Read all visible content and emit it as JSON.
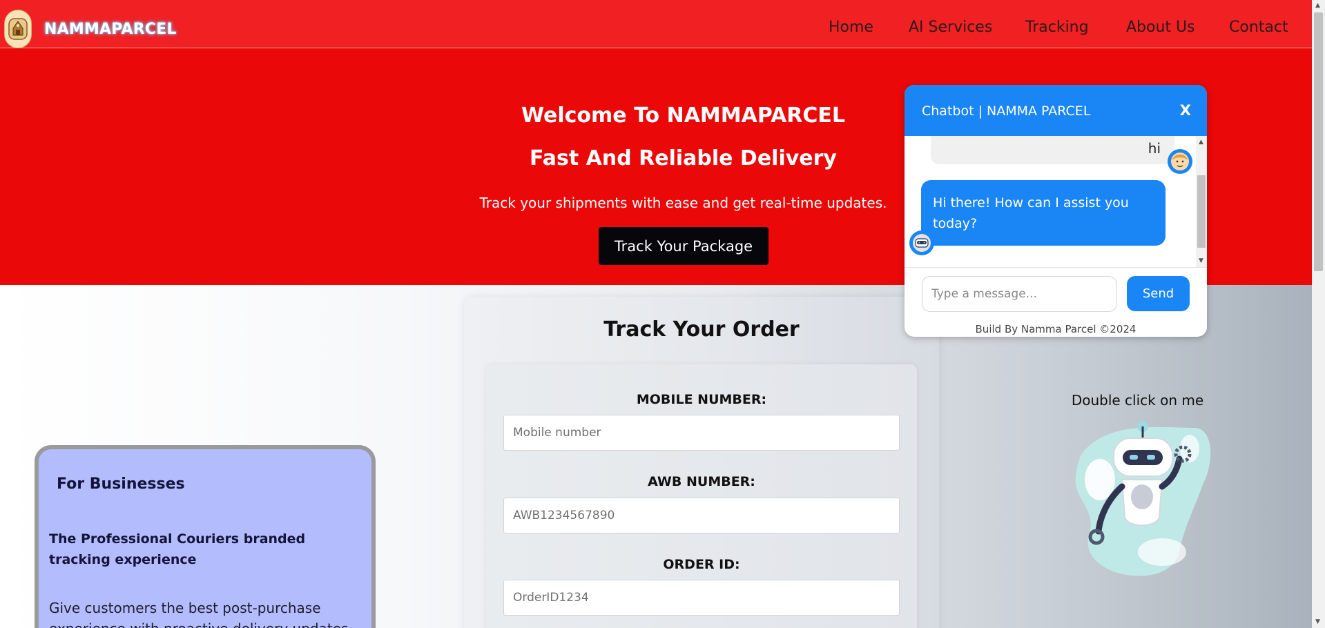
{
  "brand": {
    "name": "NAMMAPARCEL",
    "logo_icon": "temple-logo-icon"
  },
  "nav": {
    "items": [
      {
        "label": "Home"
      },
      {
        "label": "AI Services"
      },
      {
        "label": "Tracking"
      },
      {
        "label": "About Us"
      },
      {
        "label": "Contact"
      }
    ]
  },
  "hero": {
    "title_1": "Welcome To NAMMAPARCEL",
    "title_2": "Fast And Reliable Delivery",
    "subtitle": "Track your shipments with ease and get real-time updates.",
    "button_label": "Track Your Package"
  },
  "track_form": {
    "title": "Track Your Order",
    "fields": [
      {
        "label": "MOBILE NUMBER:",
        "placeholder": "Mobile number"
      },
      {
        "label": "AWB NUMBER:",
        "placeholder": "AWB1234567890"
      },
      {
        "label": "ORDER ID:",
        "placeholder": "OrderID1234"
      }
    ]
  },
  "business": {
    "title": "For Businesses",
    "subtitle": "The Professional Couriers branded tracking experience",
    "body": "Give customers the best post-purchase experience with proactive delivery updates"
  },
  "robot": {
    "hint": "Double click on me"
  },
  "chatbot": {
    "title": "Chatbot | NAMMA PARCEL",
    "close_label": "X",
    "messages": [
      {
        "sender": "user",
        "text": "hi"
      },
      {
        "sender": "bot",
        "text": "Hi there! How can I assist you today?"
      }
    ],
    "input_placeholder": "Type a message...",
    "send_label": "Send",
    "credit": "Build By Namma Parcel ©2024"
  },
  "colors": {
    "nav_bg": "#f02023",
    "hero_bg": "#eb0808",
    "chat_accent": "#1a85f5",
    "business_bg": "#b3bdfd"
  }
}
